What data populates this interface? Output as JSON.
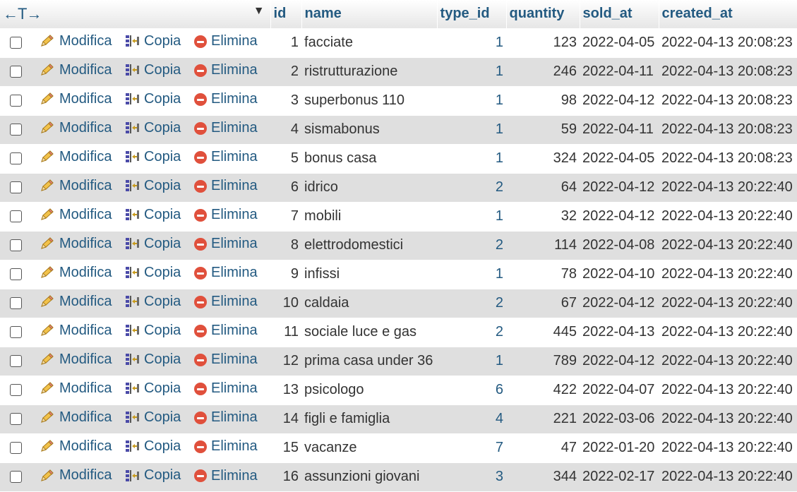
{
  "header": {
    "nav_arrows": "←T→",
    "sort_caret": "▼",
    "columns": [
      "id",
      "name",
      "type_id",
      "quantity",
      "sold_at",
      "created_at"
    ]
  },
  "actions": {
    "edit_label": "Modifica",
    "copy_label": "Copia",
    "delete_label": "Elimina",
    "edit_icon": "pencil-icon",
    "copy_icon": "copy-icon",
    "delete_icon": "delete-icon"
  },
  "rows": [
    {
      "id": "1",
      "name": "facciate",
      "type_id": "1",
      "quantity": "123",
      "sold_at": "2022-04-05",
      "created_at": "2022-04-13 20:08:23"
    },
    {
      "id": "2",
      "name": "ristrutturazione",
      "type_id": "1",
      "quantity": "246",
      "sold_at": "2022-04-11",
      "created_at": "2022-04-13 20:08:23"
    },
    {
      "id": "3",
      "name": "superbonus 110",
      "type_id": "1",
      "quantity": "98",
      "sold_at": "2022-04-12",
      "created_at": "2022-04-13 20:08:23"
    },
    {
      "id": "4",
      "name": "sismabonus",
      "type_id": "1",
      "quantity": "59",
      "sold_at": "2022-04-11",
      "created_at": "2022-04-13 20:08:23"
    },
    {
      "id": "5",
      "name": "bonus casa",
      "type_id": "1",
      "quantity": "324",
      "sold_at": "2022-04-05",
      "created_at": "2022-04-13 20:08:23"
    },
    {
      "id": "6",
      "name": "idrico",
      "type_id": "2",
      "quantity": "64",
      "sold_at": "2022-04-12",
      "created_at": "2022-04-13 20:22:40"
    },
    {
      "id": "7",
      "name": "mobili",
      "type_id": "1",
      "quantity": "32",
      "sold_at": "2022-04-12",
      "created_at": "2022-04-13 20:22:40"
    },
    {
      "id": "8",
      "name": "elettrodomestici",
      "type_id": "2",
      "quantity": "114",
      "sold_at": "2022-04-08",
      "created_at": "2022-04-13 20:22:40"
    },
    {
      "id": "9",
      "name": "infissi",
      "type_id": "1",
      "quantity": "78",
      "sold_at": "2022-04-10",
      "created_at": "2022-04-13 20:22:40"
    },
    {
      "id": "10",
      "name": "caldaia",
      "type_id": "2",
      "quantity": "67",
      "sold_at": "2022-04-12",
      "created_at": "2022-04-13 20:22:40"
    },
    {
      "id": "11",
      "name": "sociale luce e gas",
      "type_id": "2",
      "quantity": "445",
      "sold_at": "2022-04-13",
      "created_at": "2022-04-13 20:22:40"
    },
    {
      "id": "12",
      "name": "prima casa under 36",
      "type_id": "1",
      "quantity": "789",
      "sold_at": "2022-04-12",
      "created_at": "2022-04-13 20:22:40"
    },
    {
      "id": "13",
      "name": "psicologo",
      "type_id": "6",
      "quantity": "422",
      "sold_at": "2022-04-07",
      "created_at": "2022-04-13 20:22:40"
    },
    {
      "id": "14",
      "name": "figli e famiglia",
      "type_id": "4",
      "quantity": "221",
      "sold_at": "2022-03-06",
      "created_at": "2022-04-13 20:22:40"
    },
    {
      "id": "15",
      "name": "vacanze",
      "type_id": "7",
      "quantity": "47",
      "sold_at": "2022-01-20",
      "created_at": "2022-04-13 20:22:40"
    },
    {
      "id": "16",
      "name": "assunzioni giovani",
      "type_id": "3",
      "quantity": "344",
      "sold_at": "2022-02-17",
      "created_at": "2022-04-13 20:22:40"
    }
  ],
  "colors": {
    "link": "#235a81",
    "row_even": "#dfdfdf",
    "row_odd": "#ffffff",
    "delete": "#e0503c"
  }
}
